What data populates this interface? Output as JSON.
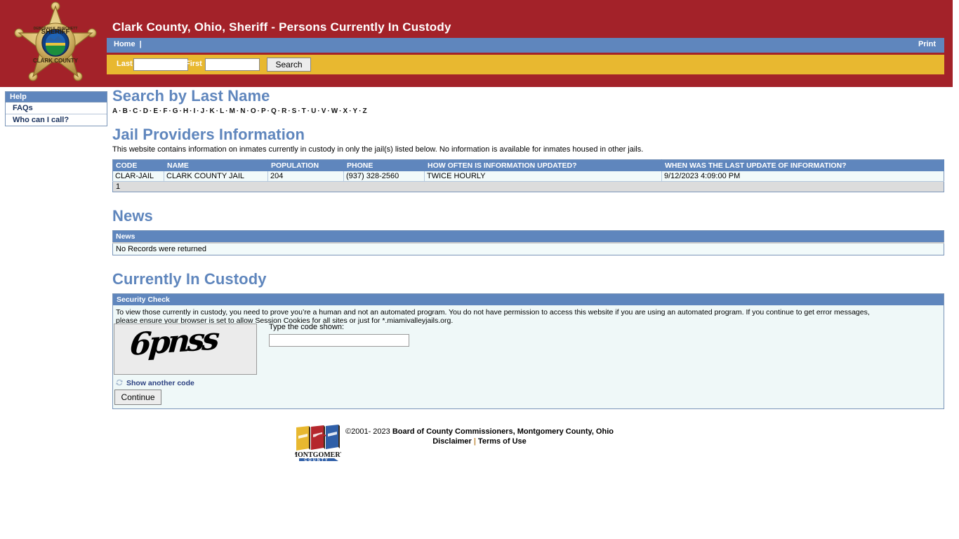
{
  "header": {
    "title": "Clark County, Ohio, Sheriff - Persons Currently In Custody",
    "badge": {
      "name": "sheriff-star-badge",
      "top_text": "DEBORAH K. BURCHETT",
      "mid_text": "SHERIFF",
      "bottom_text": "CLARK COUNTY"
    },
    "colors": {
      "header_red": "#a32229",
      "nav_blue": "#5f86bd",
      "search_gold": "#e8b830",
      "heading_blue": "#5f86bd"
    }
  },
  "nav": {
    "home_label": "Home",
    "separator": "|",
    "print_label": "Print"
  },
  "search": {
    "last_label": "Last",
    "first_label": "First",
    "last_value": "",
    "first_value": "",
    "last_placeholder": "",
    "first_placeholder": "",
    "button_label": "Search"
  },
  "sidebar": {
    "heading": "Help",
    "items": [
      {
        "label": "FAQs"
      },
      {
        "label": "Who can I call?"
      }
    ]
  },
  "search_by_last_name": {
    "heading": "Search by Last Name",
    "letters": [
      "A",
      "B",
      "C",
      "D",
      "E",
      "F",
      "G",
      "H",
      "I",
      "J",
      "K",
      "L",
      "M",
      "N",
      "O",
      "P",
      "Q",
      "R",
      "S",
      "T",
      "U",
      "V",
      "W",
      "X",
      "Y",
      "Z"
    ],
    "separator": "·"
  },
  "jail_providers": {
    "heading": "Jail Providers Information",
    "blurb": "This website contains information on inmates currently in custody in only the jail(s) listed below. No information is available for inmates housed in other jails.",
    "columns": [
      "CODE",
      "NAME",
      "POPULATION",
      "PHONE",
      "HOW OFTEN IS INFORMATION UPDATED?",
      "WHEN WAS THE LAST UPDATE OF INFORMATION?"
    ],
    "rows": [
      [
        "CLAR-JAIL",
        "CLARK COUNTY JAIL",
        "204",
        "(937) 328-2560",
        "TWICE HOURLY",
        "9/12/2023 4:09:00 PM"
      ]
    ],
    "pager": "1"
  },
  "news": {
    "heading": "News",
    "column": "News",
    "empty_message": "No Records were returned"
  },
  "custody": {
    "heading": "Currently In Custody",
    "security_check": {
      "panel_title": "Security Check",
      "paragraph_line1": "To view those currently in custody, you need to prove you’re a human and not an automated program. You do not have permission to access this website if you are using an automated program. If you continue to get error messages,",
      "paragraph_line2": "please ensure your browser is set to allow Session Cookies for all sites or just for *.miamivalleyjails.org.",
      "captcha_code": "6pnss",
      "show_another_label": "Show another code",
      "code_label": "Type the code shown:",
      "code_value": "",
      "code_placeholder": "",
      "continue_label": "Continue"
    }
  },
  "footer": {
    "copyright_prefix": "©2001- 2023 ",
    "copyright_bold": "Board of County Commissioners, Montgomery County, Ohio",
    "disclaimer_label": "Disclaimer",
    "separator": "|",
    "terms_label": "Terms of Use",
    "logo": {
      "name": "montgomery-county-logo",
      "line1": "MONTGOMERY",
      "line2": "C O U N T Y"
    }
  }
}
